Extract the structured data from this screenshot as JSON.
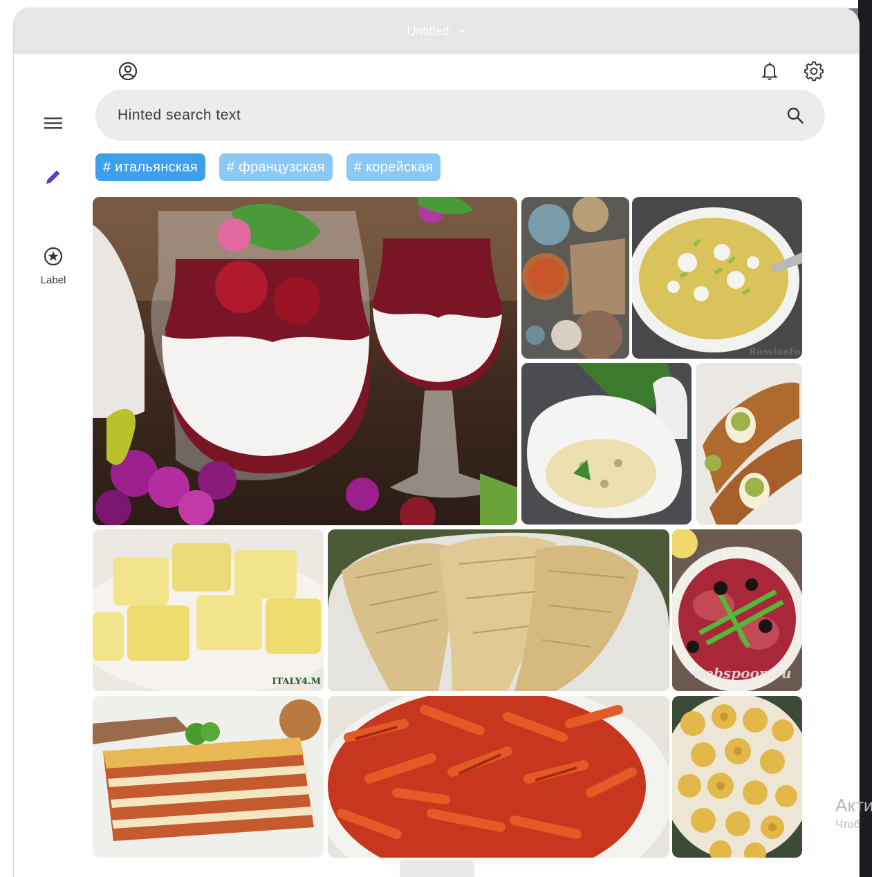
{
  "window": {
    "title": "Untitled"
  },
  "nav_rail": {
    "menu_icon": "menu-icon",
    "edit_icon": "edit-icon",
    "destinations": [
      {
        "label": "Label",
        "icon": "star-circle-icon"
      }
    ]
  },
  "top_bar": {
    "icons": [
      "account-circle-icon",
      "bell-icon",
      "gear-icon"
    ]
  },
  "search": {
    "placeholder": "Hinted search text",
    "icon": "search-icon"
  },
  "chips": [
    {
      "label": "# итальянская",
      "selected": true
    },
    {
      "label": "# французская",
      "selected": false
    },
    {
      "label": "# корейская",
      "selected": false
    }
  ],
  "gallery": {
    "tiles": [
      {
        "name": "panna-cotta-berry-dessert"
      },
      {
        "name": "pizza-and-flatbread-spread"
      },
      {
        "name": "risotto-with-cheese-and-pistachio",
        "caption": "RussianFo"
      },
      {
        "name": "mushroom-risotto"
      },
      {
        "name": "cannoli-with-pistachio"
      },
      {
        "name": "ravioli",
        "caption": "ITALY4.M"
      },
      {
        "name": "sfogliatella-pastry"
      },
      {
        "name": "beef-carpaccio",
        "caption": "webspoon.ru"
      },
      {
        "name": "lasagna"
      },
      {
        "name": "penne-arrabbiata"
      },
      {
        "name": "tortellini"
      }
    ]
  },
  "os_watermark": {
    "line1": "Акти",
    "line2": "Чтоб"
  },
  "colors": {
    "chip_selected": "#3ea0ea",
    "chip_unselected": "#8cc8f4",
    "edit_icon": "#5b3fc4",
    "search_bg": "#ececec",
    "titlebar_bg": "#e6e6e6"
  }
}
